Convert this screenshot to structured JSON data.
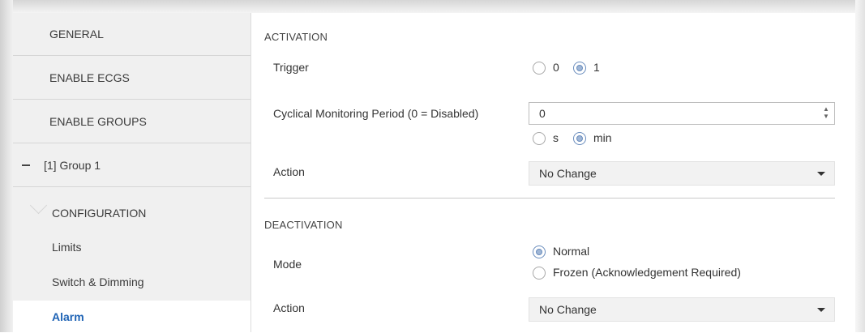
{
  "sidebar": {
    "items": [
      {
        "label": "GENERAL"
      },
      {
        "label": "ENABLE ECGS"
      },
      {
        "label": "ENABLE GROUPS"
      }
    ],
    "group": {
      "label": "[1] Group 1"
    },
    "subitems": [
      {
        "label": "CONFIGURATION"
      },
      {
        "label": "Limits"
      },
      {
        "label": "Switch & Dimming"
      },
      {
        "label": "Alarm"
      }
    ]
  },
  "activation": {
    "title": "ACTIVATION",
    "trigger": {
      "label": "Trigger",
      "options": [
        "0",
        "1"
      ],
      "selected": "1"
    },
    "period": {
      "label": "Cyclical Monitoring Period (0 = Disabled)",
      "value": "0"
    },
    "unit": {
      "options": [
        "s",
        "min"
      ],
      "selected": "min"
    },
    "action": {
      "label": "Action",
      "value": "No Change"
    }
  },
  "deactivation": {
    "title": "DEACTIVATION",
    "mode": {
      "label": "Mode",
      "options": [
        "Normal",
        "Frozen (Acknowledgement Required)"
      ],
      "selected": "Normal"
    },
    "action": {
      "label": "Action",
      "value": "No Change"
    }
  },
  "colors": {
    "active_item": "#1e63b5",
    "sidebar_bg": "#f0f0f0"
  }
}
